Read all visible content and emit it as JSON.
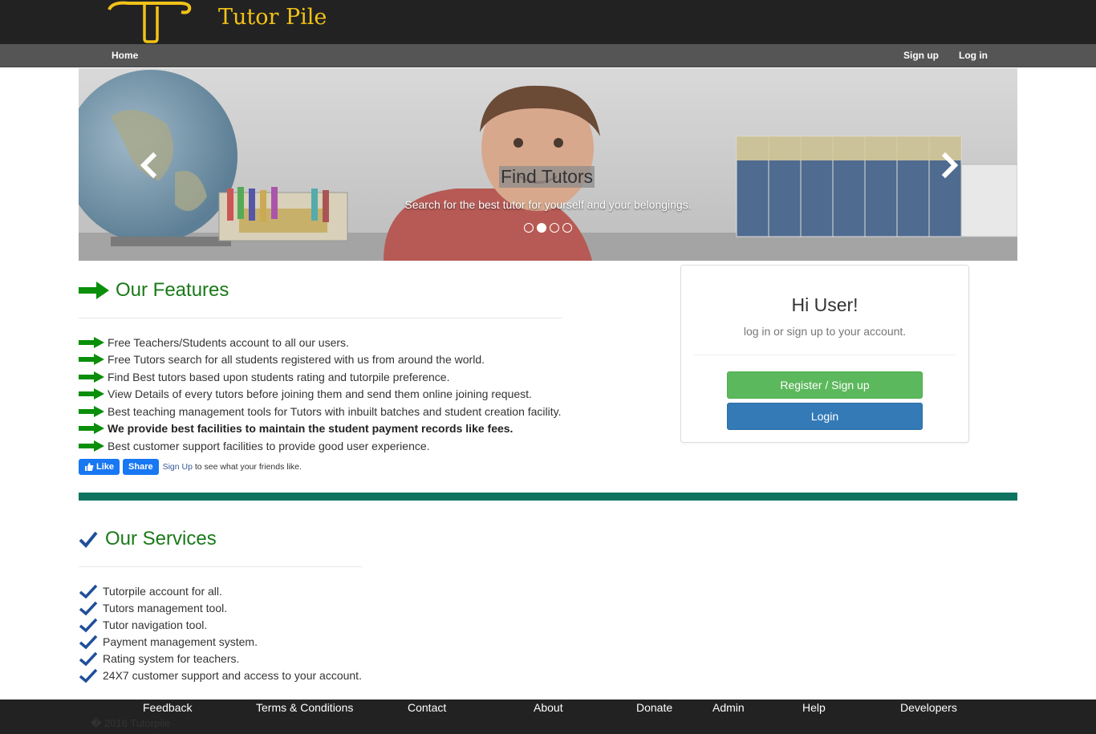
{
  "header": {
    "site_title": "Tutor Pile",
    "logo": "tutor-pile-logo"
  },
  "nav": {
    "home": "Home",
    "signup": "Sign up",
    "login": "Log in"
  },
  "carousel": {
    "title": "Find Tutors",
    "text": "Search for the best tutor for yourself and your belongings.",
    "prev_icon": "chevron-left-icon",
    "next_icon": "chevron-right-icon",
    "slide_count": 4,
    "active_slide": 2
  },
  "features": {
    "heading": "Our Features",
    "items": [
      "Free Teachers/Students account to all our users.",
      "Free Tutors search for all students registered with us from around the world.",
      "Find Best tutors based upon students rating and tutorpile preference.",
      "View Details of every tutors before joining them and send them online joining request.",
      "Best teaching management tools for Tutors with inbuilt batches and student creation facility.",
      "We provide best facilities to maintain the student payment records like fees.",
      "Best customer support facilities to provide good user experience."
    ]
  },
  "facebook": {
    "like": "Like",
    "share": "Share",
    "signup_link": "Sign Up",
    "text": " to see what your friends like."
  },
  "panel": {
    "title": "Hi User!",
    "subtitle": "log in or sign up to your account.",
    "register": "Register / Sign up",
    "login": "Login"
  },
  "services": {
    "heading": "Our Services",
    "items": [
      "Tutorpile account for all.",
      "Tutors management tool.",
      "Tutor navigation tool.",
      "Payment management system.",
      "Rating system for teachers.",
      "24X7 customer support and access to your account."
    ]
  },
  "footer": {
    "links": [
      "Feedback",
      "Terms & Conditions",
      "Contact",
      "About",
      "Donate",
      "Admin",
      "Help",
      "Developers"
    ],
    "copyright": "� 2016 Tutorpile"
  },
  "colors": {
    "green_heading": "#1a7a1a",
    "arrow_green": "#0a8f0a",
    "check_blue": "#1f4f9a",
    "teal": "#0e7461",
    "logo_gold": "#f2c218"
  }
}
